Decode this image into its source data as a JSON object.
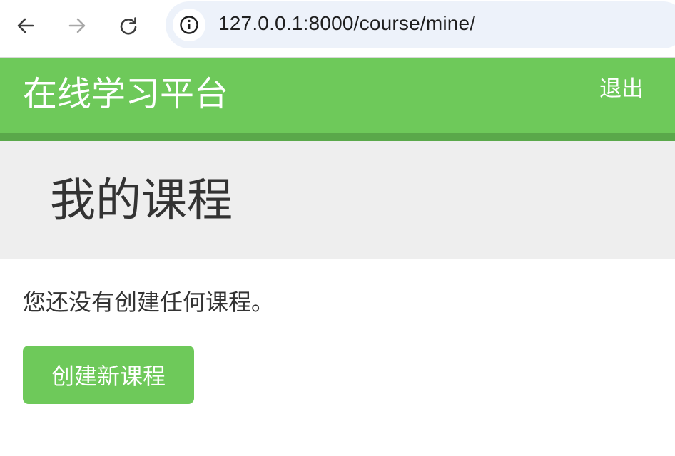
{
  "browser": {
    "url": "127.0.0.1:8000/course/mine/",
    "icons": {
      "back": "arrow-left-icon",
      "forward": "arrow-right-icon",
      "reload": "reload-icon",
      "site_info": "info-icon"
    }
  },
  "header": {
    "logo": "在线学习平台",
    "logout_label": "退出",
    "colors": {
      "primary": "#6ec95a",
      "stripe": "#5aa84a"
    }
  },
  "main": {
    "page_title": "我的课程",
    "empty_message": "您还没有创建任何课程。",
    "create_button_label": "创建新课程"
  }
}
